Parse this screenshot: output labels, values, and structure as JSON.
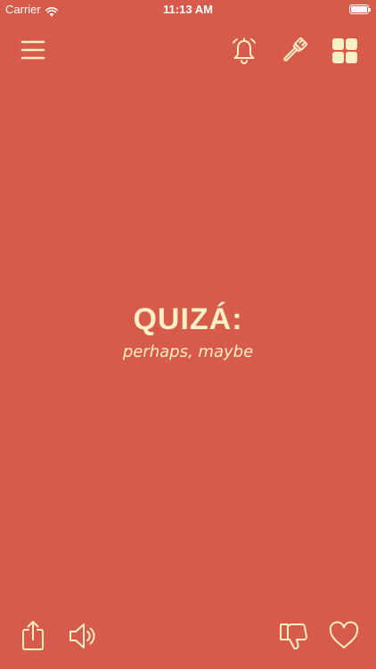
{
  "status_bar": {
    "carrier": "Carrier",
    "time": "11:13 AM",
    "wifi_icon": "wifi-icon",
    "battery_icon": "battery-icon"
  },
  "toolbar": {
    "menu_icon": "hamburger-menu-icon",
    "bell_icon": "bell-icon",
    "brush_icon": "paint-brush-icon",
    "grid_icon": "grid-icon"
  },
  "card": {
    "word": "QUIZÁ:",
    "translation": "perhaps, maybe"
  },
  "bottom_bar": {
    "share_icon": "share-icon",
    "speaker_icon": "speaker-icon",
    "dislike_icon": "thumbs-down-icon",
    "like_icon": "heart-icon"
  },
  "colors": {
    "background": "#D65B4A",
    "foreground": "#FBEFC6",
    "status_text": "#FFFFFF"
  }
}
